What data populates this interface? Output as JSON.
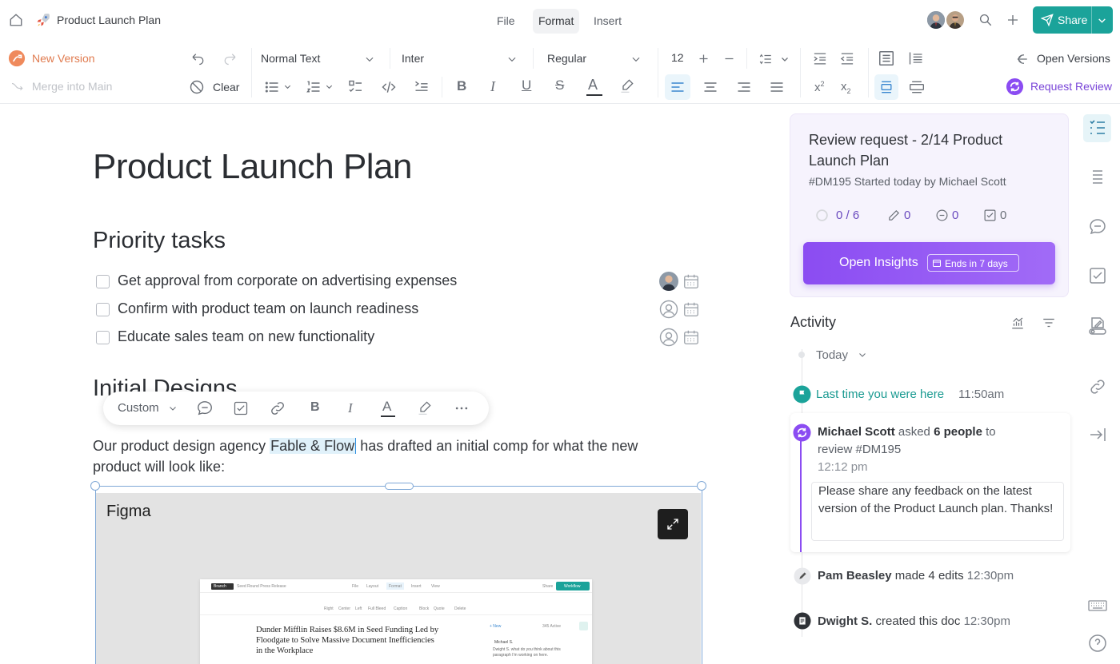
{
  "app": {
    "doc_name": "Product Launch Plan",
    "colors": {
      "accent": "#1ba39a",
      "purple": "#8b4cf2",
      "orange": "#e07b4f"
    }
  },
  "menu": {
    "file": "File",
    "format": "Format",
    "insert": "Insert"
  },
  "header": {
    "share_label": "Share"
  },
  "toolbar": {
    "new_version": "New Version",
    "merge_main": "Merge into Main",
    "clear": "Clear",
    "text_style": "Normal Text",
    "font_family": "Inter",
    "font_weight": "Regular",
    "font_size": "12",
    "open_versions": "Open Versions",
    "request_review": "Request Review"
  },
  "document": {
    "title": "Product Launch Plan",
    "priority_heading": "Priority tasks",
    "tasks": [
      {
        "text": "Get approval from corporate on advertising expenses"
      },
      {
        "text": "Confirm with product team on launch readiness"
      },
      {
        "text": "Educate sales team on new functionality"
      }
    ],
    "designs_heading": "Initial Designs",
    "para_before": "Our product design agency ",
    "para_highlight": "Fable & Flow",
    "para_after": " has drafted an initial comp for what the new",
    "para_line2": "product will look like:",
    "float_toolbar_style": "Custom",
    "figma_label": "Figma",
    "mini": {
      "branch": "Branch",
      "doc": "Seed Round Press Release",
      "menu": [
        "File",
        "Layout",
        "Format",
        "Insert",
        "View"
      ],
      "share": "Share",
      "workflow": "Workflow",
      "tools": [
        "Right",
        "Center",
        "Left",
        "Full Bleed",
        "Caption",
        "Block",
        "Quote",
        "Delete"
      ],
      "headline": "Dunder Mifflin Raises $8.6M in Seed Funding Led by Floodgate to Solve Massive Document Inefficiencies in the Workplace",
      "new": "+ New",
      "active": "345 Active",
      "commenter": "Michael S.",
      "comment": "Dwight S. what do you think about this paragraph I'm working on here."
    }
  },
  "review": {
    "title": "Review request - 2/14 Product Launch Plan",
    "subtitle": "#DM195 Started today by Michael Scott",
    "progress": "0 / 6",
    "edits": "0",
    "comments": "0",
    "checks": "0",
    "button": "Open Insights",
    "ends": "Ends in 7 days"
  },
  "activity": {
    "heading": "Activity",
    "filter": "Today",
    "last_here": "Last time you were here",
    "last_time": "11:50am",
    "req_name": "Michael Scott",
    "req_asked": " asked ",
    "req_people": "6 people",
    "req_to": " to",
    "req_line2": "review #DM195",
    "req_time": "12:12 pm",
    "req_comment": "Please share any feedback on the latest version of the Product Launch plan. Thanks!",
    "pam_name": "Pam Beasley",
    "pam_action": " made 4 edits ",
    "pam_time": "12:30pm",
    "dwight_name": "Dwight S.",
    "dwight_action": " created this doc ",
    "dwight_time": "12:30pm"
  }
}
